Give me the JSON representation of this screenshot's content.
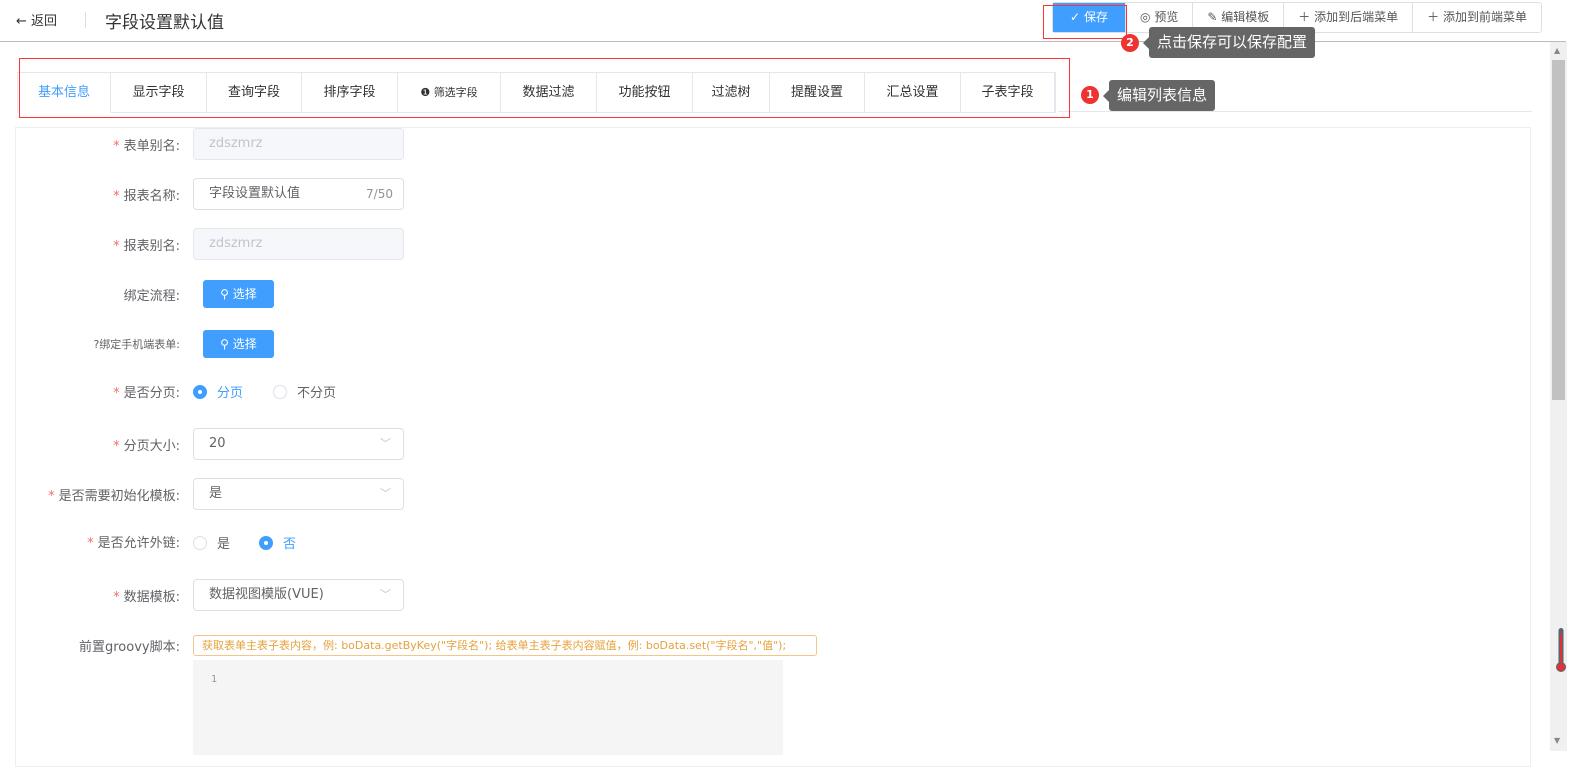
{
  "header": {
    "back_label": "返回",
    "title": "字段设置默认值",
    "buttons": {
      "save": "保存",
      "preview": "预览",
      "edit_template": "编辑模板",
      "add_backend_menu": "添加到后端菜单",
      "add_frontend_menu": "添加到前端菜单"
    }
  },
  "tooltips": [
    {
      "badge": "1",
      "text": "编辑列表信息"
    },
    {
      "badge": "2",
      "text": "点击保存可以保存配置"
    }
  ],
  "tabs": [
    "基本信息",
    "显示字段",
    "查询字段",
    "排序字段",
    "筛选字段",
    "数据过滤",
    "功能按钮",
    "过滤树",
    "提醒设置",
    "汇总设置",
    "子表字段"
  ],
  "form": {
    "form_alias": {
      "label": "表单别名:",
      "value": "zdszmrz"
    },
    "report_name": {
      "label": "报表名称:",
      "value": "字段设置默认值",
      "count": "7/50"
    },
    "report_alias": {
      "label": "报表别名:",
      "value": "zdszmrz"
    },
    "bind_flow": {
      "label": "绑定流程:",
      "button": "选择"
    },
    "bind_mobile": {
      "label": "绑定手机端表单:",
      "button": "选择"
    },
    "paging": {
      "label": "是否分页:",
      "options": [
        "分页",
        "不分页"
      ],
      "selected": "分页"
    },
    "page_size": {
      "label": "分页大小:",
      "value": "20"
    },
    "init_template": {
      "label": "是否需要初始化模板:",
      "value": "是"
    },
    "allow_external": {
      "label": "是否允许外链:",
      "options": [
        "是",
        "否"
      ],
      "selected": "否"
    },
    "data_template": {
      "label": "数据模板:",
      "value": "数据视图模版(VUE)"
    },
    "groovy": {
      "label": "前置groovy脚本:",
      "hint": "获取表单主表子表内容，例: boData.getByKey(\"字段名\"); 给表单主表子表内容赋值，例: boData.set(\"字段名\",\"值\");",
      "line": "1"
    }
  },
  "colors": {
    "primary": "#409eff",
    "required": "#f56c6c",
    "annotation": "#ff3333"
  }
}
